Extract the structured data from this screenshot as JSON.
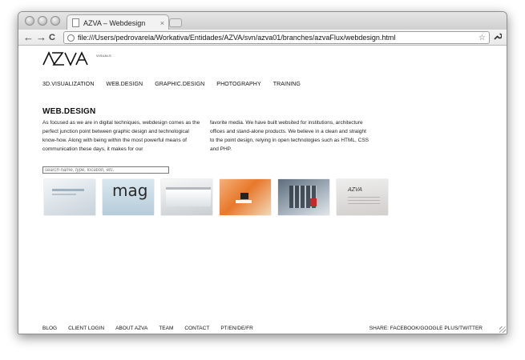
{
  "browser": {
    "tab_title": "AZVA – Webdesign",
    "tab_close": "×",
    "back": "←",
    "forward": "→",
    "reload": "C",
    "url": "file:///Users/pedrovarela/Workativa/Entidades/AZVA/svn/azva01/branches/azvaFlux/webdesign.html",
    "star": "☆",
    "wrench": "🔧"
  },
  "logo": {
    "text": "AZVA",
    "sub": "VISUALS"
  },
  "nav": {
    "items": [
      "3D.VISUALIZATION",
      "WEB.DESIGN",
      "GRAPHIC.DESIGN",
      "PHOTOGRAPHY",
      "TRAINING"
    ]
  },
  "page": {
    "title": "WEB.DESIGN",
    "intro_left": "As focused as we are in digital techniques, webdesign comes as the perfect junction point between graphic design and technological know-how. Along with being within the most powerful means of communication these days, it makes for our",
    "intro_right": "favorite media. We have built websited for institutions, architecture offices and stand-alone products. We believe in a clean and straight to the point design, relying in open technologies such as HTML, CSS and PHP.",
    "search_placeholder": "search name, type, location, etc."
  },
  "thumbnails": {
    "mag_text": "mag",
    "mini_logo": "AZVA"
  },
  "footer": {
    "links": [
      "BLOG",
      "CLIENT LOGIN",
      "ABOUT AZVA",
      "TEAM",
      "CONTACT",
      "PT/EN/DE/FR"
    ],
    "share": "SHARE: FACEBOOK/GOOGLE PLUS/TWITTER"
  }
}
